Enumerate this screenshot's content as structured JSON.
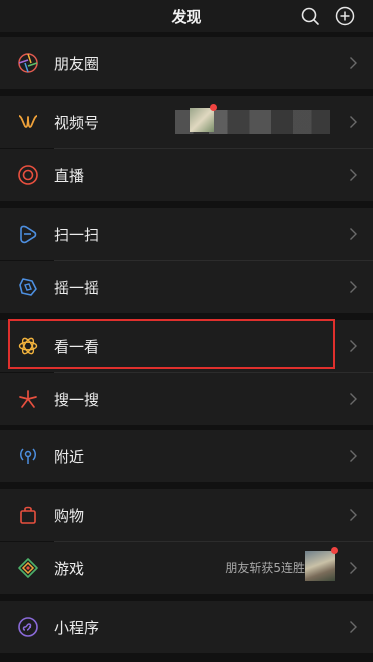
{
  "header": {
    "title": "发现"
  },
  "menu": {
    "moments": "朋友圈",
    "channels": "视频号",
    "live": "直播",
    "scan": "扫一扫",
    "shake": "摇一摇",
    "top_stories": "看一看",
    "search": "搜一搜",
    "nearby": "附近",
    "shopping": "购物",
    "games": "游戏",
    "games_note": "朋友斩获5连胜",
    "mini_programs": "小程序"
  },
  "icons": [
    "search-icon",
    "add-icon",
    "moments-icon",
    "channels-icon",
    "live-icon",
    "scan-icon",
    "shake-icon",
    "top-stories-icon",
    "search-feature-icon",
    "nearby-icon",
    "shopping-icon",
    "games-icon",
    "mini-programs-icon",
    "chevron-right-icon"
  ],
  "colors": {
    "highlight": "#e0302d",
    "badge": "#f04340",
    "background": "#111111",
    "row": "#1d1d1d"
  }
}
